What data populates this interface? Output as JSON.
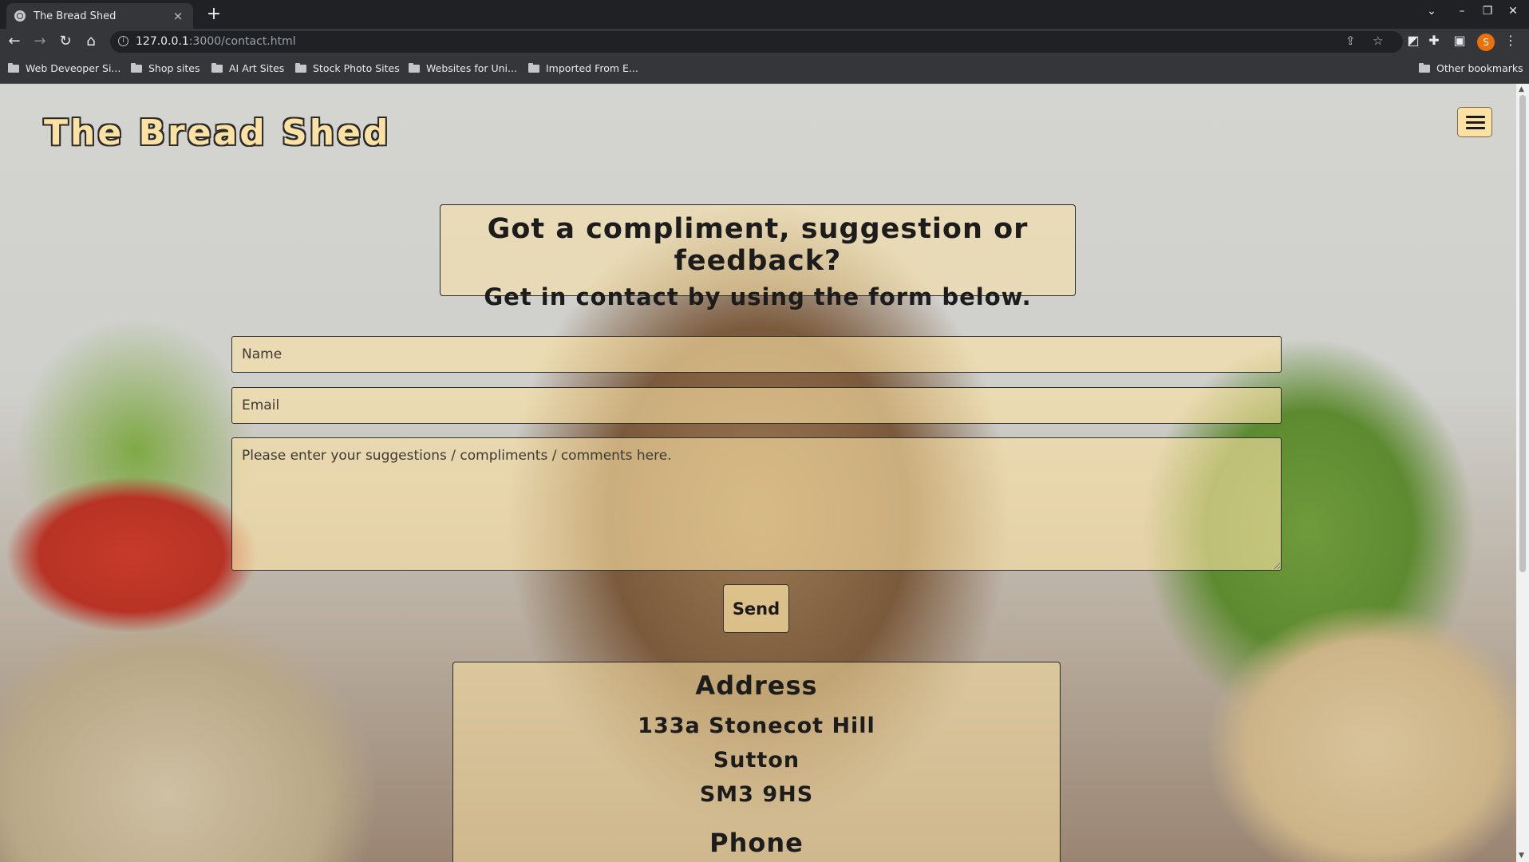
{
  "browser": {
    "tab_title": "The Bread Shed",
    "tab_close": "×",
    "new_tab": "+",
    "url_host": "127.0.0.1",
    "url_path": ":3000/contact.html",
    "avatar_letter": "S",
    "bookmarks": [
      {
        "label": "Web Deveoper Si..."
      },
      {
        "label": "Shop sites"
      },
      {
        "label": "AI Art Sites"
      },
      {
        "label": "Stock Photo Sites"
      },
      {
        "label": "Websites for Uni..."
      },
      {
        "label": "Imported From E..."
      }
    ],
    "other_bookmarks": "Other bookmarks"
  },
  "header": {
    "brand": "The Bread Shed"
  },
  "contact": {
    "heading": "Got a compliment, suggestion or feedback?",
    "subheading": "Get in contact by using the form below.",
    "name_placeholder": "Name",
    "email_placeholder": "Email",
    "message_placeholder": "Please enter your suggestions / compliments / comments here.",
    "send_label": "Send"
  },
  "address": {
    "title": "Address",
    "line1": "133a Stonecot Hill",
    "line2": "Sutton",
    "line3": "SM3 9HS",
    "phone_title": "Phone"
  },
  "colors": {
    "panel": "#fbe2a4",
    "text": "#1c1c1c",
    "chrome_dark": "#202124",
    "chrome_light": "#35363a"
  }
}
